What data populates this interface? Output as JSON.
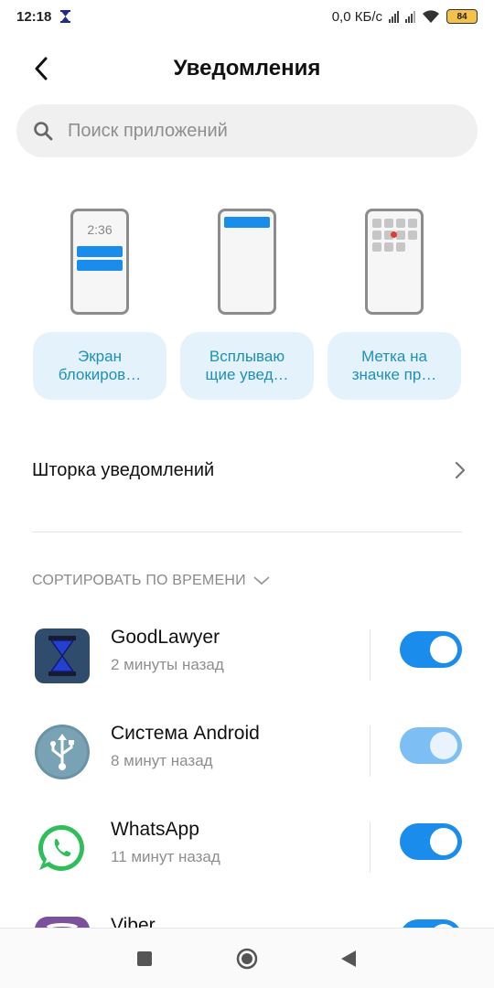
{
  "status_bar": {
    "time": "12:18",
    "network_speed": "0,0 КБ/с",
    "battery_level": "84",
    "icons": [
      "hourglass-icon",
      "signal-icon",
      "signal-icon",
      "wifi-icon",
      "battery-icon"
    ]
  },
  "header": {
    "title": "Уведомления",
    "back_icon": "chevron-left-icon"
  },
  "search": {
    "placeholder": "Поиск приложений",
    "value": ""
  },
  "notification_styles": [
    {
      "label": "Экран\nблокиров…",
      "preview_clock": "2:36"
    },
    {
      "label": "Всплываю\nщие увед…"
    },
    {
      "label": "Метка на\nзначке пр…"
    }
  ],
  "shade": {
    "label": "Шторка уведомлений"
  },
  "sort": {
    "label": "СОРТИРОВАТЬ ПО ВРЕМЕНИ"
  },
  "apps": [
    {
      "name": "GoodLawyer",
      "time": "2 минуты назад",
      "enabled": true,
      "disabled_control": false,
      "icon": "hourglass-icon"
    },
    {
      "name": "Система Android",
      "time": "8 минут назад",
      "enabled": true,
      "disabled_control": true,
      "icon": "usb-icon"
    },
    {
      "name": "WhatsApp",
      "time": "11 минут назад",
      "enabled": true,
      "disabled_control": false,
      "icon": "whatsapp-icon"
    },
    {
      "name": "Viber",
      "time": "",
      "enabled": true,
      "disabled_control": false,
      "icon": "viber-icon"
    }
  ],
  "colors": {
    "accent": "#1a8ceb",
    "accent_disabled": "#7dbff4",
    "chip_bg": "#e4f3fb",
    "chip_text": "#1f8fba"
  },
  "navigation": {
    "buttons": [
      "recents-square-icon",
      "home-circle-icon",
      "back-triangle-icon"
    ]
  }
}
